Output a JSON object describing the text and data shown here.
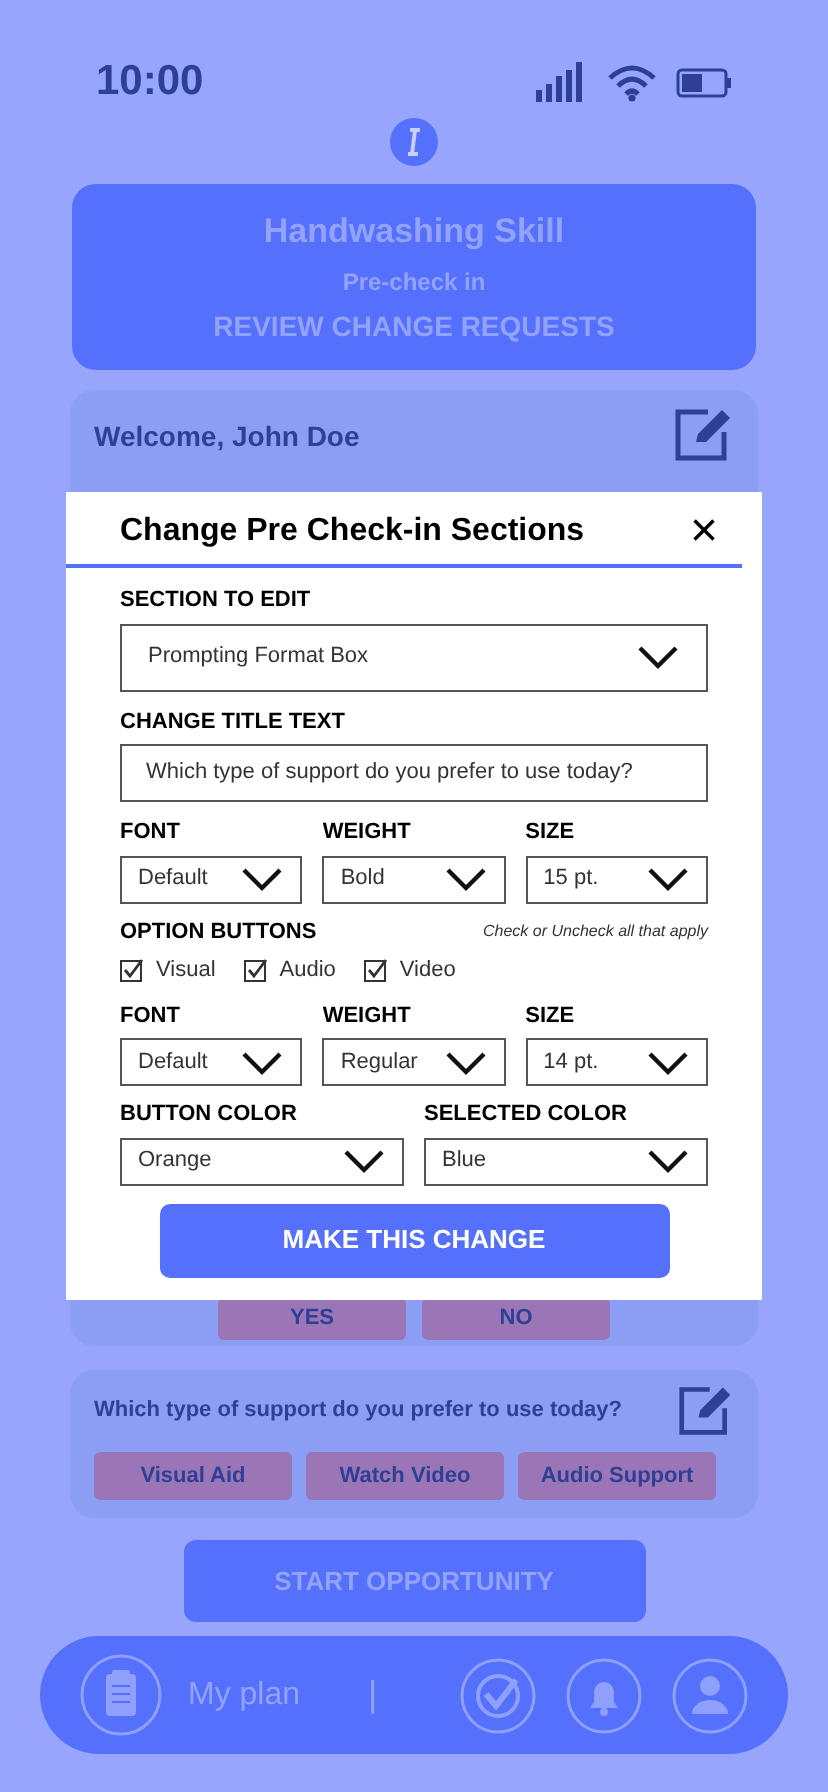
{
  "status_bar": {
    "time": "10:00"
  },
  "header": {
    "title": "Handwashing Skill",
    "subtitle": "Pre-check in",
    "link": "REVIEW CHANGE REQUESTS"
  },
  "welcome_card": {
    "title": "Welcome, John Doe",
    "answers": [
      "YES",
      "NO"
    ]
  },
  "support_card": {
    "question": "Which type of support do you prefer to use today?",
    "options": [
      "Visual Aid",
      "Watch Video",
      "Audio Support"
    ]
  },
  "start_button": "START OPPORTUNITY",
  "bottom_nav": {
    "label": "My plan",
    "divider": "|"
  },
  "modal": {
    "title": "Change Pre Check-in Sections",
    "close": "×",
    "section_label": "SECTION TO EDIT",
    "section_value": "Prompting Format Box",
    "title_label": "CHANGE TITLE TEXT",
    "title_value": "Which type of support do you prefer to use today?",
    "title_style": [
      {
        "label": "FONT",
        "value": "Default"
      },
      {
        "label": "WEIGHT",
        "value": "Bold"
      },
      {
        "label": "SIZE",
        "value": "15 pt."
      }
    ],
    "options_label": "OPTION BUTTONS",
    "options_hint": "Check or Uncheck all that apply",
    "options": [
      {
        "label": "Visual",
        "checked": true
      },
      {
        "label": "Audio",
        "checked": true
      },
      {
        "label": "Video",
        "checked": true
      }
    ],
    "button_style": [
      {
        "label": "FONT",
        "value": "Default"
      },
      {
        "label": "WEIGHT",
        "value": "Regular"
      },
      {
        "label": "SIZE",
        "value": "14 pt."
      }
    ],
    "colors": [
      {
        "label": "BUTTON COLOR",
        "value": "Orange"
      },
      {
        "label": "SELECTED COLOR",
        "value": "Blue"
      }
    ],
    "submit": "MAKE THIS CHANGE"
  }
}
